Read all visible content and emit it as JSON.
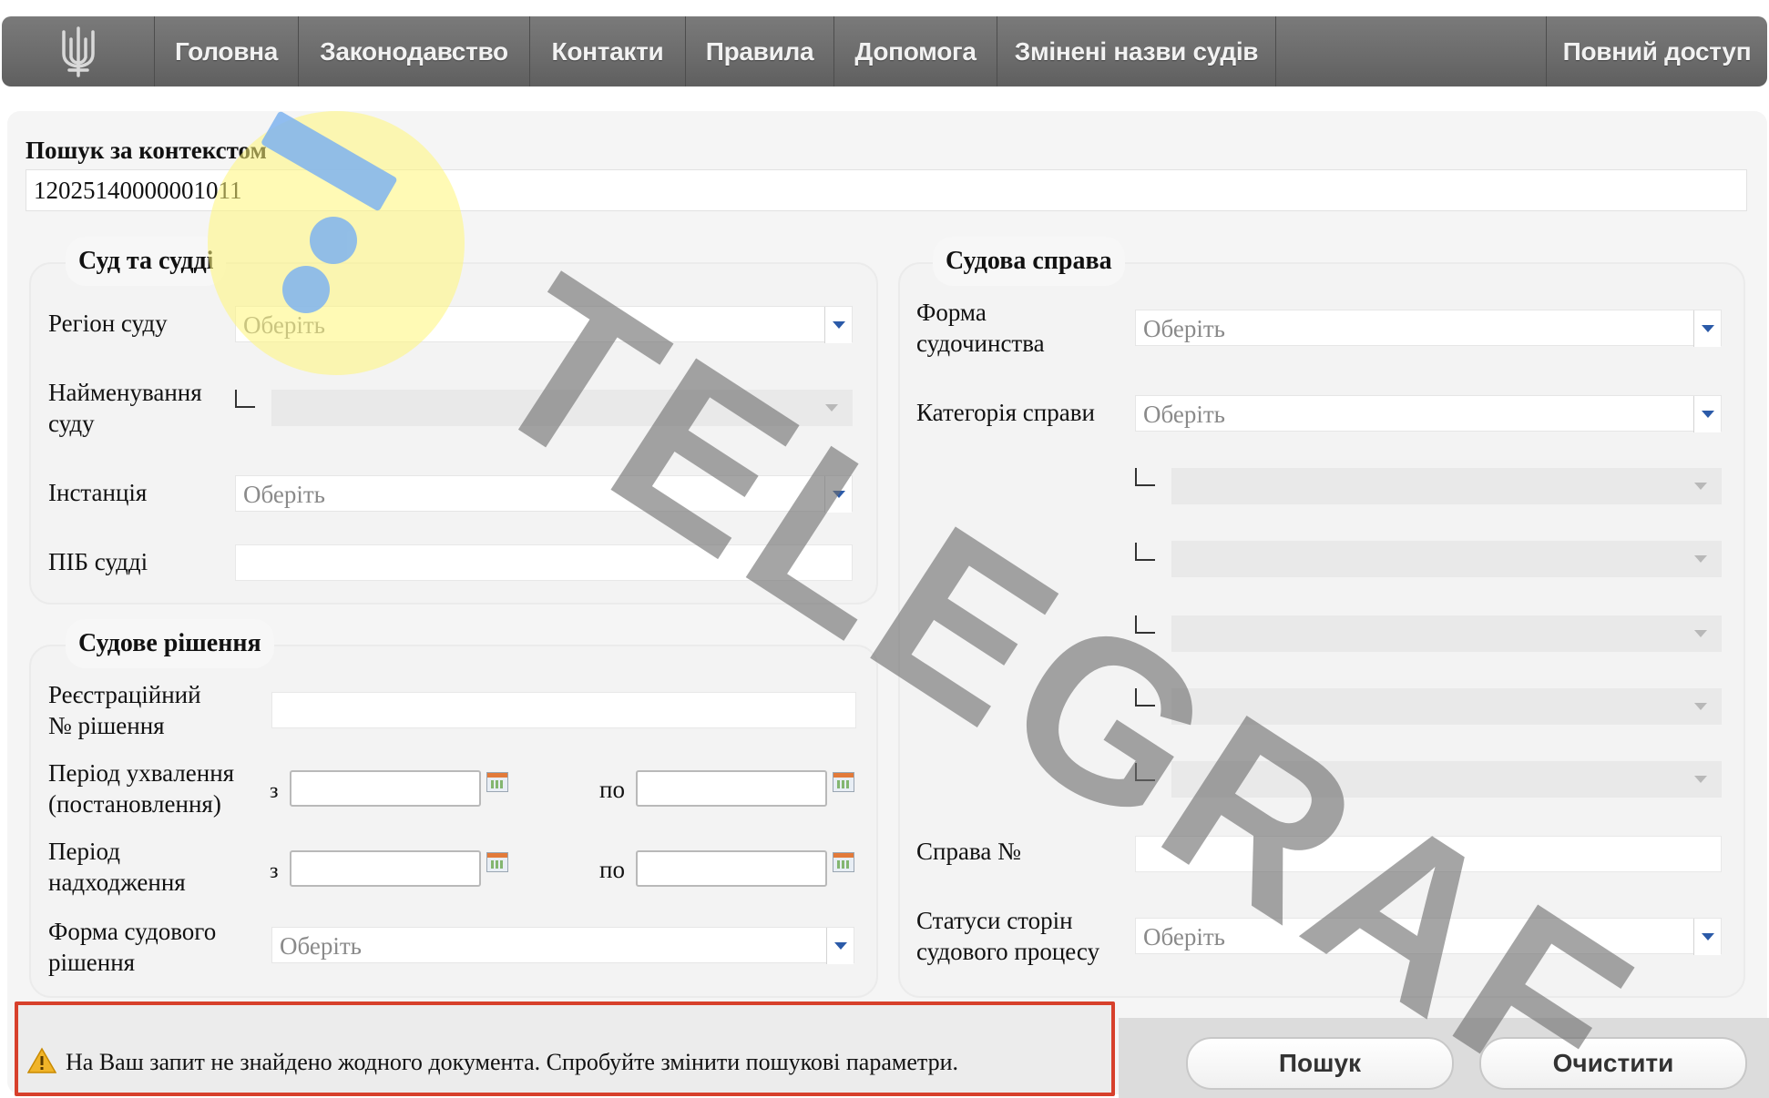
{
  "nav": {
    "items": [
      "Головна",
      "Законодавство",
      "Контакти",
      "Правила",
      "Допомога",
      "Змінені назви судів"
    ],
    "full_access": "Повний доступ"
  },
  "search": {
    "label": "Пошук за контекстом",
    "value": "12025140000001011"
  },
  "court": {
    "legend": "Суд та судді",
    "region_label": "Регіон суду",
    "name_label_1": "Найменування",
    "name_label_2": "суду",
    "instance_label": "Інстанція",
    "judge_label": "ПІБ судді",
    "placeholder": "Оберіть"
  },
  "decision": {
    "legend": "Судове рішення",
    "reg_label_1": "Реєстраційний",
    "reg_label_2": "№ рішення",
    "adopt_label_1": "Період ухвалення",
    "adopt_label_2": "(постановлення)",
    "receive_label_1": "Період",
    "receive_label_2": "надходження",
    "from": "з",
    "to": "по",
    "form_label_1": "Форма судового",
    "form_label_2": "рішення",
    "placeholder": "Оберіть"
  },
  "case": {
    "legend": "Судова справа",
    "form_label_1": "Форма",
    "form_label_2": "судочинства",
    "category_label": "Категорія справи",
    "case_no_label": "Справа №",
    "status_label_1": "Статуси сторін",
    "status_label_2": "судового процесу",
    "placeholder": "Оберіть"
  },
  "footer": {
    "alert": "На Ваш запит не знайдено жодного документа. Спробуйте змінити пошукові параметри.",
    "search_button": "Пошук",
    "clear_button": "Очистити"
  },
  "watermark": "TELEGRAF",
  "colors": {
    "nav": "#6b6b6b",
    "alert_border": "#d7402b",
    "combo_arrow": "#2b5aa8",
    "watermark_badge": "#fff578"
  }
}
